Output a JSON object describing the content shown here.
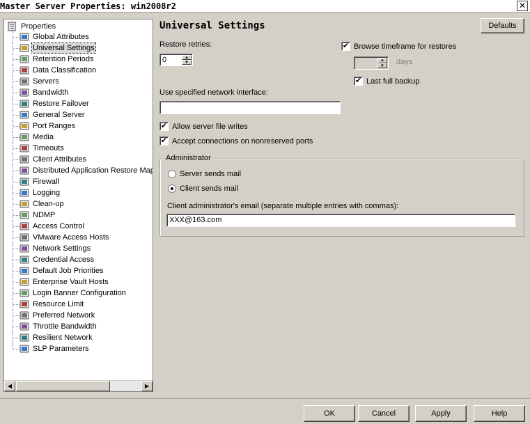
{
  "window": {
    "title": "Master Server Properties: win2008r2",
    "close_label": "✕"
  },
  "tree": {
    "root_label": "Properties",
    "items": [
      {
        "label": "Global Attributes",
        "icon": "globe-icon",
        "selected": false
      },
      {
        "label": "Universal Settings",
        "icon": "universal-settings-icon",
        "selected": true
      },
      {
        "label": "Retention Periods",
        "icon": "retention-icon",
        "selected": false
      },
      {
        "label": "Data Classification",
        "icon": "data-classification-icon",
        "selected": false
      },
      {
        "label": "Servers",
        "icon": "servers-icon",
        "selected": false
      },
      {
        "label": "Bandwidth",
        "icon": "bandwidth-icon",
        "selected": false
      },
      {
        "label": "Restore Failover",
        "icon": "restore-failover-icon",
        "selected": false
      },
      {
        "label": "General Server",
        "icon": "general-server-icon",
        "selected": false
      },
      {
        "label": "Port Ranges",
        "icon": "port-ranges-icon",
        "selected": false
      },
      {
        "label": "Media",
        "icon": "media-icon",
        "selected": false
      },
      {
        "label": "Timeouts",
        "icon": "clock-icon",
        "selected": false
      },
      {
        "label": "Client Attributes",
        "icon": "client-attributes-icon",
        "selected": false
      },
      {
        "label": "Distributed Application Restore Map",
        "icon": "restore-map-icon",
        "selected": false
      },
      {
        "label": "Firewall",
        "icon": "firewall-icon",
        "selected": false
      },
      {
        "label": "Logging",
        "icon": "logging-icon",
        "selected": false
      },
      {
        "label": "Clean-up",
        "icon": "cleanup-icon",
        "selected": false
      },
      {
        "label": "NDMP",
        "icon": "ndmp-icon",
        "selected": false
      },
      {
        "label": "Access Control",
        "icon": "access-control-icon",
        "selected": false
      },
      {
        "label": "VMware Access Hosts",
        "icon": "vmware-icon",
        "selected": false
      },
      {
        "label": "Network Settings",
        "icon": "network-icon",
        "selected": false
      },
      {
        "label": "Credential Access",
        "icon": "credential-icon",
        "selected": false
      },
      {
        "label": "Default Job Priorities",
        "icon": "priorities-icon",
        "selected": false
      },
      {
        "label": "Enterprise Vault Hosts",
        "icon": "vault-icon",
        "selected": false
      },
      {
        "label": "Login Banner Configuration",
        "icon": "login-banner-icon",
        "selected": false
      },
      {
        "label": "Resource Limit",
        "icon": "resource-limit-icon",
        "selected": false
      },
      {
        "label": "Preferred Network",
        "icon": "preferred-network-icon",
        "selected": false
      },
      {
        "label": "Throttle Bandwidth",
        "icon": "throttle-icon",
        "selected": false
      },
      {
        "label": "Resilient Network",
        "icon": "resilient-network-icon",
        "selected": false
      },
      {
        "label": "SLP Parameters",
        "icon": "slp-icon",
        "selected": false
      }
    ]
  },
  "panel": {
    "heading": "Universal Settings",
    "defaults_button": "Defaults",
    "restore_retries_label": "Restore retries:",
    "restore_retries_value": "0",
    "network_interface_label": "Use specified network interface:",
    "network_interface_value": "",
    "allow_server_file_writes": {
      "label": "Allow server file writes",
      "checked": true
    },
    "accept_nonreserved_ports": {
      "label": "Accept connections on nonreserved ports",
      "checked": true
    },
    "browse_timeframe": {
      "label": "Browse timeframe for restores",
      "checked": true
    },
    "days_value": "",
    "days_label": "days",
    "last_full_backup": {
      "label": "Last full backup",
      "checked": true
    },
    "administrator": {
      "legend": "Administrator",
      "server_sends_mail": {
        "label": "Server sends mail",
        "selected": false
      },
      "client_sends_mail": {
        "label": "Client sends mail",
        "selected": true
      },
      "email_label": "Client administrator's email (separate multiple entries with commas):",
      "email_value": "XXX@163.com"
    }
  },
  "footer": {
    "ok": "OK",
    "cancel": "Cancel",
    "apply": "Apply",
    "help": "Help"
  },
  "colors": {
    "background": "#d4d0c8",
    "selection": "#d9d9d9"
  }
}
